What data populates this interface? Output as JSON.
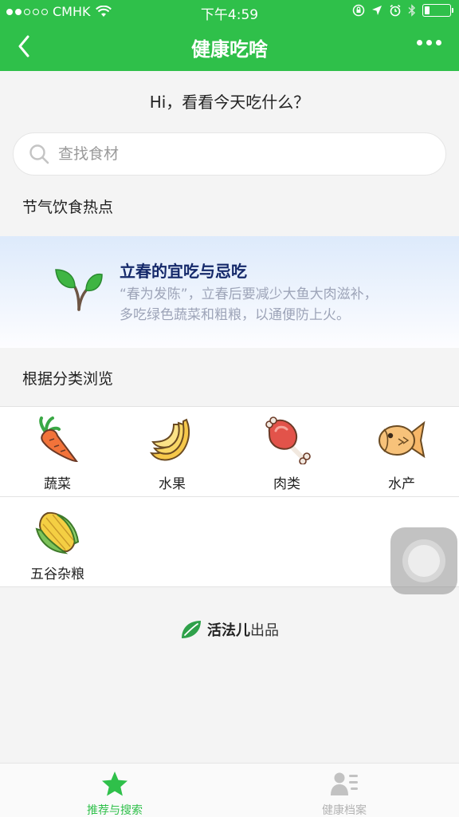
{
  "status_bar": {
    "carrier": "CMHK",
    "time": "下午4:59",
    "signal_bars_filled": 2,
    "signal_bars_total": 5,
    "battery_level": 0.2
  },
  "nav": {
    "title": "健康吃啥",
    "back_icon": "chevron-left-icon",
    "more_icon": "more-dots-icon"
  },
  "greeting": "Hi，看看今天吃什么？",
  "search": {
    "placeholder": "查找食材",
    "value": ""
  },
  "solar_term": {
    "section_title": "节气饮食热点",
    "card_title": "立春的宜吃与忌吃",
    "card_desc": "“春为发陈”，立春后要减少大鱼大肉滋补，多吃绿色蔬菜和粗粮，以通便防上火。",
    "icon": "sprout-icon"
  },
  "categories": {
    "section_title": "根据分类浏览",
    "items": [
      {
        "label": "蔬菜",
        "icon": "carrot-icon"
      },
      {
        "label": "水果",
        "icon": "banana-icon"
      },
      {
        "label": "肉类",
        "icon": "meat-icon"
      },
      {
        "label": "水产",
        "icon": "fish-icon"
      },
      {
        "label": "五谷杂粮",
        "icon": "corn-icon"
      }
    ]
  },
  "brand": {
    "name": "活法儿",
    "suffix": "出品",
    "icon": "leaf-icon"
  },
  "tabbar": {
    "tabs": [
      {
        "label": "推荐与搜索",
        "icon": "star-icon",
        "active": true
      },
      {
        "label": "健康档案",
        "icon": "profile-icon",
        "active": false
      }
    ]
  },
  "colors": {
    "brand_green": "#2fc04a",
    "tab_inactive": "#b3b3b3",
    "card_title": "#15296a",
    "card_desc": "#9da4b8"
  }
}
